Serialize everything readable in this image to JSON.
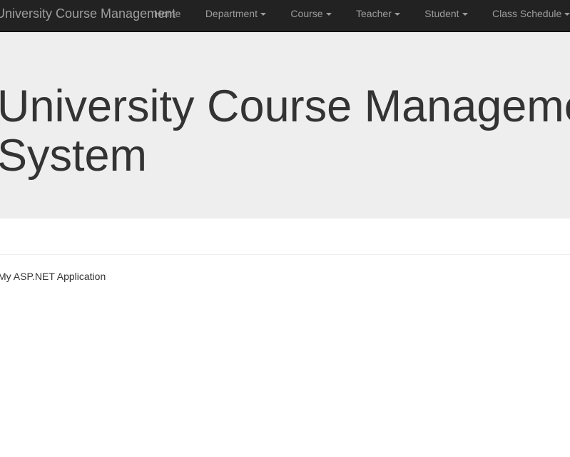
{
  "navbar": {
    "brand": "University Course Management",
    "items": [
      {
        "label": "Home",
        "dropdown": false
      },
      {
        "label": "Department",
        "dropdown": true
      },
      {
        "label": "Course",
        "dropdown": true
      },
      {
        "label": "Teacher",
        "dropdown": true
      },
      {
        "label": "Student",
        "dropdown": true
      },
      {
        "label": "Class Schedule",
        "dropdown": true
      }
    ]
  },
  "jumbotron": {
    "title_line1": "University Course Management",
    "title_line2": "System"
  },
  "footer": {
    "text": "My ASP.NET Application"
  },
  "colors": {
    "navbar_bg": "#222222",
    "navbar_text": "#9d9d9d",
    "jumbotron_bg": "#eeeeee",
    "text": "#333333"
  }
}
